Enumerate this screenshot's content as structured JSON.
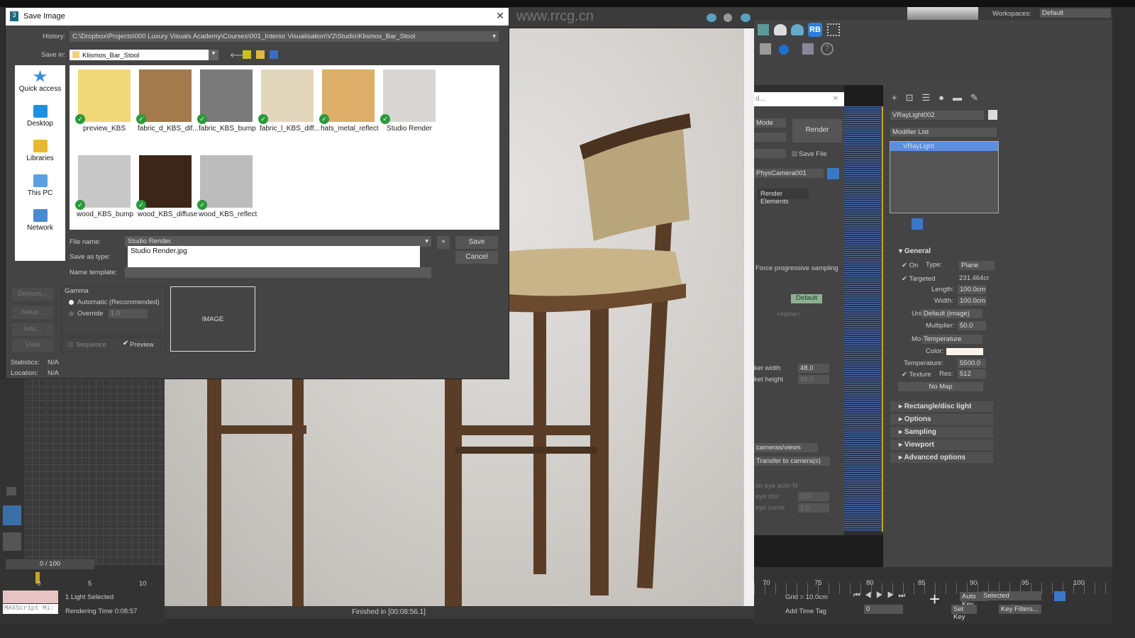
{
  "dialog": {
    "title": "Save Image",
    "history_label": "History:",
    "history_value": "C:\\Dropbox\\Projects\\000 Luxury Visuals Academy\\Courses\\001_Interior Visualisation\\V2\\Studio\\Klismos_Bar_Stool",
    "save_in_label": "Save in:",
    "save_in_value": "Klismos_Bar_Stool",
    "places": [
      {
        "label": "Quick access",
        "color": "#3a8fd8"
      },
      {
        "label": "Desktop",
        "color": "#1e90e0"
      },
      {
        "label": "Libraries",
        "color": "#e8b830"
      },
      {
        "label": "This PC",
        "color": "#5aa0e0"
      },
      {
        "label": "Network",
        "color": "#4a8ad0"
      }
    ],
    "files": [
      {
        "name": "preview_KBS",
        "color": "#f0d878"
      },
      {
        "name": "fabric_d_KBS_dif...",
        "color": "#a27a4c"
      },
      {
        "name": "fabric_KBS_bump",
        "color": "#7a7a7a"
      },
      {
        "name": "fabric_l_KBS_diff...",
        "color": "#e2d6bc"
      },
      {
        "name": "hats_metal_reflect",
        "color": "#dcae68"
      },
      {
        "name": "Studio Render",
        "color": "#d8d6d2"
      },
      {
        "name": "wood_KBS_bump",
        "color": "#c8c8c8"
      },
      {
        "name": "wood_KBS_diffuse",
        "color": "#3c2619"
      },
      {
        "name": "wood_KBS_reflect",
        "color": "#bcbcbc"
      }
    ],
    "file_name_label": "File name:",
    "file_name_value": "Studio Render.",
    "autocomplete": "Studio Render.jpg",
    "save_as_type_label": "Save as type:",
    "name_template_label": "Name template:",
    "plus_label": "+",
    "save_label": "Save",
    "cancel_label": "Cancel",
    "devices": "Devices...",
    "setup": "Setup...",
    "info": "Info...",
    "view": "View",
    "gamma_label": "Gamma",
    "gamma_auto": "Automatic (Recommended)",
    "gamma_override": "Override",
    "override_value": "1.0",
    "sequence": "Sequence",
    "preview": "Preview",
    "image_placeholder": "IMAGE",
    "statistics_label": "Statistics:",
    "statistics_value": "N/A",
    "location_label": "Location:",
    "location_value": "N/A"
  },
  "render_window": {
    "watermark": "www.rrcg.cn",
    "status": "Finished in [00:08:56.1]"
  },
  "render_setup": {
    "title": "d...",
    "mode": "Mode",
    "render": "Render",
    "save_file": "Save File",
    "camera": "PhysCamera001",
    "tab": "Render Elements",
    "force_progressive": "Force progressive sampling",
    "default": "Default",
    "none": "<None>",
    "bucket_width_label": "ket width",
    "bucket_width": "48.0",
    "bucket_height_label": "ket height",
    "bucket_height": "48.0",
    "cameras": "cameras/views",
    "transfer": "Transfer to camera(s)",
    "fisheye": "sh eye auto-fit",
    "eye_dist": "eye dist",
    "eye_dist_val": "2.0",
    "eye_curve": "eye curve",
    "eye_curve_val": "1.0"
  },
  "top": {
    "workspaces_label": "Workspaces:",
    "workspace": "Default"
  },
  "command_panel": {
    "object_name": "VRayLight002",
    "modifier_list": "Modifier List",
    "stack_item": "VRayLight",
    "general": "General",
    "on": "On",
    "type_label": "Type:",
    "type": "Plane",
    "targeted": "Targeted",
    "target_dist": "231.464cr",
    "length_label": "Length:",
    "length": "100.0cm",
    "width_label": "Width:",
    "width": "100.0cm",
    "units_label": "Units:",
    "units": "Default (image)",
    "multiplier_label": "Multiplier:",
    "multiplier": "50.0",
    "mode_label": "Mode:",
    "mode": "Temperature",
    "color_label": "Color:",
    "temperature_label": "Temperature:",
    "temperature": "5500.0",
    "texture": "Texture",
    "res_label": "Res:",
    "res": "512",
    "no_map": "No Map",
    "rollouts": [
      "Rectangle/disc light",
      "Options",
      "Sampling",
      "Viewport",
      "Advanced options"
    ]
  },
  "timeline": {
    "frame": "0 / 100",
    "ticks_left": [
      "0",
      "5",
      "10"
    ],
    "ticks_right": [
      "70",
      "75",
      "80",
      "85",
      "90",
      "95",
      "100"
    ],
    "selected_status": "1 Light Selected",
    "rendering_time": "Rendering Time  0:08:57",
    "maxscript": "MAXScript Mi:",
    "grid": "Grid = 10.0cm",
    "add_time_tag": "Add Time Tag",
    "frame_input": "0",
    "auto_key": "Auto Key",
    "set_key": "Set Key",
    "selected": "Selected",
    "key_filters": "Key Filters..."
  }
}
